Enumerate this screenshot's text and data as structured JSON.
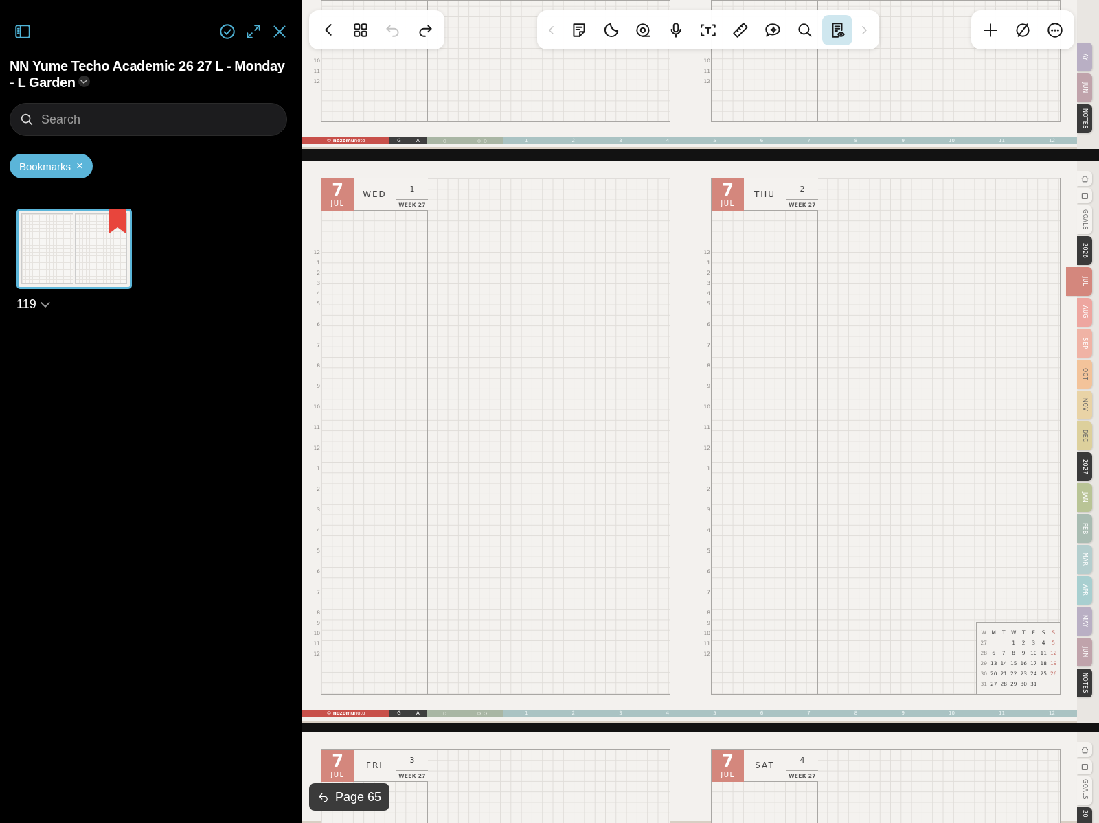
{
  "sidebar": {
    "title": "NN Yume Techo Academic 26 27 L - Monday - L Garden",
    "search": {
      "placeholder": "Search"
    },
    "filter": {
      "label": "Bookmarks",
      "remove": "×"
    },
    "pages": [
      {
        "label": "119",
        "selected": true,
        "bookmarked": true
      }
    ]
  },
  "toolbar": {
    "navigation": [
      {
        "disabled": false
      },
      {
        "disabled": false
      },
      {
        "disabled": true
      },
      {
        "disabled": false
      }
    ],
    "tools": [
      {
        "disabled": true,
        "selected": false
      },
      {
        "disabled": false,
        "selected": false
      },
      {
        "disabled": false,
        "selected": false
      },
      {
        "disabled": false,
        "selected": false
      },
      {
        "disabled": false,
        "selected": false
      },
      {
        "disabled": false,
        "selected": false
      },
      {
        "disabled": false,
        "selected": false
      },
      {
        "disabled": false,
        "selected": false
      },
      {
        "disabled": false,
        "selected": false
      },
      {
        "disabled": false,
        "selected": true
      },
      {
        "disabled": true,
        "selected": false
      }
    ]
  },
  "spreads": [
    {
      "kind": "tail",
      "pages": [
        {
          "hours": [
            {
              "label": "10",
              "kind": "short"
            },
            {
              "label": "11",
              "kind": "short"
            },
            {
              "label": "12",
              "kind": "short"
            }
          ]
        },
        {
          "hours": [
            {
              "label": "10",
              "kind": "short"
            },
            {
              "label": "11",
              "kind": "short"
            },
            {
              "label": "12",
              "kind": "short"
            }
          ]
        }
      ],
      "footer": {
        "brand": "© **nozomu**noto",
        "sections": [
          "G",
          "A"
        ],
        "months": [
          "1",
          "2",
          "3",
          "4",
          "5",
          "6",
          "7",
          "8",
          "9",
          "10",
          "11",
          "12"
        ]
      },
      "tabs": [
        {
          "kind": "text",
          "label": "AY",
          "color": "#b9afc4",
          "selected": false
        },
        {
          "kind": "text",
          "label": "JUN",
          "color": "#c0a3ab",
          "selected": false
        },
        {
          "kind": "text",
          "label": "NOTES",
          "color": "#3a3a3a",
          "selected": false
        }
      ]
    },
    {
      "kind": "full",
      "pages": [
        {
          "header": {
            "month_number": "7",
            "month": "JUL",
            "weekday": "WED",
            "day": "1",
            "week": "WEEK 27"
          },
          "hours": [
            {
              "label": "12",
              "kind": "short"
            },
            {
              "label": "1",
              "kind": "short"
            },
            {
              "label": "2",
              "kind": "short"
            },
            {
              "label": "3",
              "kind": "short"
            },
            {
              "label": "4",
              "kind": "short"
            },
            {
              "label": "5",
              "kind": "long"
            },
            {
              "label": "6",
              "kind": "long"
            },
            {
              "label": "7",
              "kind": "long"
            },
            {
              "label": "8",
              "kind": "long"
            },
            {
              "label": "9",
              "kind": "long"
            },
            {
              "label": "10",
              "kind": "long"
            },
            {
              "label": "11",
              "kind": "long"
            },
            {
              "label": "12",
              "kind": "long"
            },
            {
              "label": "1",
              "kind": "long"
            },
            {
              "label": "2",
              "kind": "long"
            },
            {
              "label": "3",
              "kind": "long"
            },
            {
              "label": "4",
              "kind": "long"
            },
            {
              "label": "5",
              "kind": "long"
            },
            {
              "label": "6",
              "kind": "long"
            },
            {
              "label": "7",
              "kind": "long"
            },
            {
              "label": "8",
              "kind": "short"
            },
            {
              "label": "9",
              "kind": "short"
            },
            {
              "label": "10",
              "kind": "short"
            },
            {
              "label": "11",
              "kind": "short"
            },
            {
              "label": "12",
              "kind": "short"
            }
          ]
        },
        {
          "header": {
            "month_number": "7",
            "month": "JUL",
            "weekday": "THU",
            "day": "2",
            "week": "WEEK 27"
          },
          "hours": [
            {
              "label": "12",
              "kind": "short"
            },
            {
              "label": "1",
              "kind": "short"
            },
            {
              "label": "2",
              "kind": "short"
            },
            {
              "label": "3",
              "kind": "short"
            },
            {
              "label": "4",
              "kind": "short"
            },
            {
              "label": "5",
              "kind": "long"
            },
            {
              "label": "6",
              "kind": "long"
            },
            {
              "label": "7",
              "kind": "long"
            },
            {
              "label": "8",
              "kind": "long"
            },
            {
              "label": "9",
              "kind": "long"
            },
            {
              "label": "10",
              "kind": "long"
            },
            {
              "label": "11",
              "kind": "long"
            },
            {
              "label": "12",
              "kind": "long"
            },
            {
              "label": "1",
              "kind": "long"
            },
            {
              "label": "2",
              "kind": "long"
            },
            {
              "label": "3",
              "kind": "long"
            },
            {
              "label": "4",
              "kind": "long"
            },
            {
              "label": "5",
              "kind": "long"
            },
            {
              "label": "6",
              "kind": "long"
            },
            {
              "label": "7",
              "kind": "long"
            },
            {
              "label": "8",
              "kind": "short"
            },
            {
              "label": "9",
              "kind": "short"
            },
            {
              "label": "10",
              "kind": "short"
            },
            {
              "label": "11",
              "kind": "short"
            },
            {
              "label": "12",
              "kind": "short"
            }
          ],
          "mini_calendar": {
            "weekdays": [
              "W",
              "M",
              "T",
              "W",
              "T",
              "F",
              "S",
              "S"
            ],
            "weeks": [
              {
                "week": "27",
                "days": [
                  "1",
                  "2",
                  "3",
                  "4",
                  "5"
                ]
              },
              {
                "week": "28",
                "days": [
                  "6",
                  "7",
                  "8",
                  "9",
                  "10",
                  "11",
                  "12"
                ]
              },
              {
                "week": "29",
                "days": [
                  "13",
                  "14",
                  "15",
                  "16",
                  "17",
                  "18",
                  "19"
                ]
              },
              {
                "week": "30",
                "days": [
                  "20",
                  "21",
                  "22",
                  "23",
                  "24",
                  "25",
                  "26"
                ]
              },
              {
                "week": "31",
                "days": [
                  "27",
                  "28",
                  "29",
                  "30",
                  "31"
                ]
              }
            ]
          }
        }
      ],
      "footer": {
        "brand": "© **nozomu**noto",
        "sections": [
          "G",
          "A"
        ],
        "months": [
          "1",
          "2",
          "3",
          "4",
          "5",
          "6",
          "7",
          "8",
          "9",
          "10",
          "11",
          "12"
        ]
      },
      "tabs": [
        {
          "kind": "home",
          "color": "#f4f2ef",
          "selected": false
        },
        {
          "kind": "page",
          "color": "#f4f2ef",
          "selected": false
        },
        {
          "kind": "text",
          "label": "GOALS",
          "color": "#f4f2ef",
          "selected": false
        },
        {
          "kind": "text",
          "label": "2026",
          "color": "#3a3a3a",
          "selected": false
        },
        {
          "kind": "text",
          "label": "JUL",
          "color": "#d4877d",
          "selected": true
        },
        {
          "kind": "text",
          "label": "AUG",
          "color": "#eea6a0",
          "selected": false
        },
        {
          "kind": "text",
          "label": "SEP",
          "color": "#f0b3a5",
          "selected": false
        },
        {
          "kind": "text",
          "label": "OCT",
          "color": "#f3c39a",
          "selected": false
        },
        {
          "kind": "text",
          "label": "NOV",
          "color": "#e9d3a6",
          "selected": false
        },
        {
          "kind": "text",
          "label": "DEC",
          "color": "#ddd09c",
          "selected": false
        },
        {
          "kind": "text",
          "label": "2027",
          "color": "#3a3a3a",
          "selected": false
        },
        {
          "kind": "text",
          "label": "JAN",
          "color": "#b9c496",
          "selected": false
        },
        {
          "kind": "text",
          "label": "FEB",
          "color": "#a9bcb2",
          "selected": false
        },
        {
          "kind": "text",
          "label": "MAR",
          "color": "#b4cece",
          "selected": false
        },
        {
          "kind": "text",
          "label": "APR",
          "color": "#a8cfd0",
          "selected": false
        },
        {
          "kind": "text",
          "label": "MAY",
          "color": "#b9afc4",
          "selected": false
        },
        {
          "kind": "text",
          "label": "JUN",
          "color": "#c0a3ab",
          "selected": false
        },
        {
          "kind": "text",
          "label": "NOTES",
          "color": "#3a3a3a",
          "selected": false
        }
      ]
    },
    {
      "kind": "head",
      "pages": [
        {
          "header": {
            "month_number": "7",
            "month": "JUL",
            "weekday": "FRI",
            "day": "3",
            "week": "WEEK 27"
          }
        },
        {
          "header": {
            "month_number": "7",
            "month": "JUL",
            "weekday": "SAT",
            "day": "4",
            "week": "WEEK 27"
          }
        }
      ],
      "tabs": [
        {
          "kind": "home",
          "color": "#f4f2ef",
          "selected": false
        },
        {
          "kind": "page",
          "color": "#f4f2ef",
          "selected": false
        },
        {
          "kind": "text",
          "label": "GOALS",
          "color": "#f4f2ef",
          "selected": false
        },
        {
          "kind": "text",
          "label": "20",
          "color": "#3a3a3a",
          "selected": false
        }
      ]
    }
  ],
  "back_button": {
    "label": "Page 65"
  }
}
